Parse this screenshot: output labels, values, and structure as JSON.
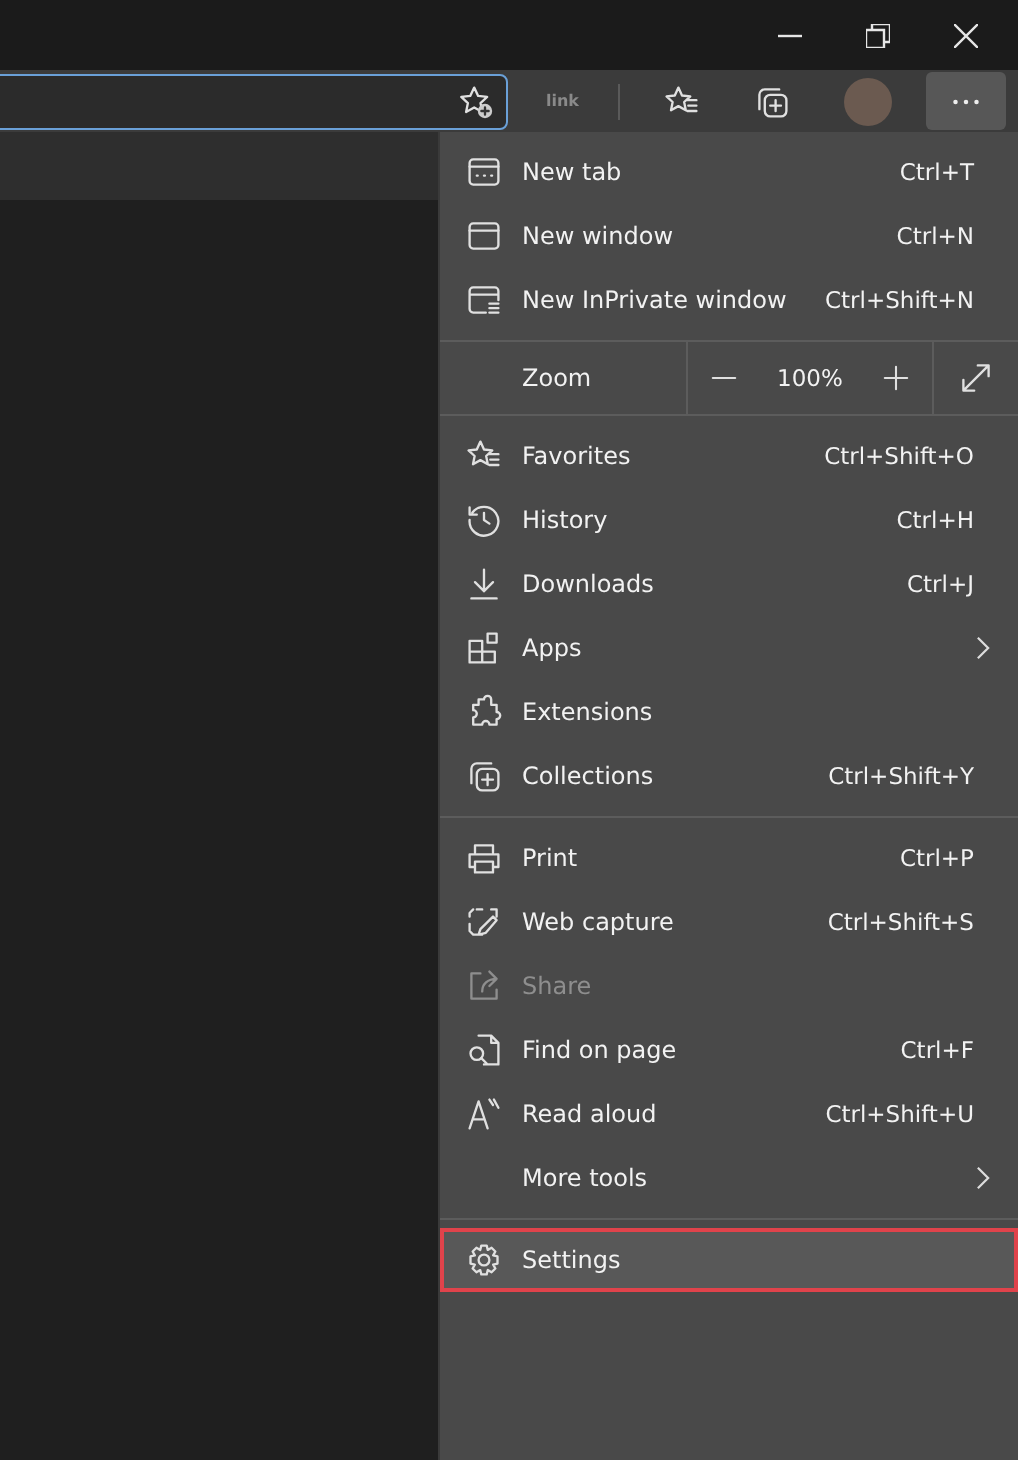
{
  "toolbar": {
    "link_label": "link"
  },
  "menu": {
    "sections": [
      [
        {
          "kind": "item",
          "label": "New tab",
          "shortcut": "Ctrl+T",
          "disabled": false,
          "selected": false
        },
        {
          "kind": "item",
          "label": "New window",
          "shortcut": "Ctrl+N",
          "disabled": false,
          "selected": false
        },
        {
          "kind": "item",
          "label": "New InPrivate window",
          "shortcut": "Ctrl+Shift+N",
          "disabled": false,
          "selected": false
        }
      ],
      [
        {
          "kind": "zoom",
          "label": "Zoom",
          "value": "100%",
          "disabled": false,
          "selected": false
        }
      ],
      [
        {
          "kind": "item",
          "label": "Favorites",
          "shortcut": "Ctrl+Shift+O",
          "disabled": false,
          "selected": false
        },
        {
          "kind": "item",
          "label": "History",
          "shortcut": "Ctrl+H",
          "disabled": false,
          "selected": false
        },
        {
          "kind": "item",
          "label": "Downloads",
          "shortcut": "Ctrl+J",
          "disabled": false,
          "selected": false
        },
        {
          "kind": "submenu",
          "label": "Apps",
          "disabled": false,
          "selected": false
        },
        {
          "kind": "item",
          "label": "Extensions",
          "disabled": false,
          "selected": false
        },
        {
          "kind": "item",
          "label": "Collections",
          "shortcut": "Ctrl+Shift+Y",
          "disabled": false,
          "selected": false
        }
      ],
      [
        {
          "kind": "item",
          "label": "Print",
          "shortcut": "Ctrl+P",
          "disabled": false,
          "selected": false
        },
        {
          "kind": "item",
          "label": "Web capture",
          "shortcut": "Ctrl+Shift+S",
          "disabled": false,
          "selected": false
        },
        {
          "kind": "item",
          "label": "Share",
          "disabled": true,
          "selected": false
        },
        {
          "kind": "item",
          "label": "Find on page",
          "shortcut": "Ctrl+F",
          "disabled": false,
          "selected": false
        },
        {
          "kind": "item",
          "label": "Read aloud",
          "shortcut": "Ctrl+Shift+U",
          "disabled": false,
          "selected": false
        },
        {
          "kind": "submenu",
          "label": "More tools",
          "disabled": false,
          "selected": false
        }
      ],
      [
        {
          "kind": "item",
          "label": "Settings",
          "disabled": false,
          "selected": true
        }
      ]
    ]
  }
}
